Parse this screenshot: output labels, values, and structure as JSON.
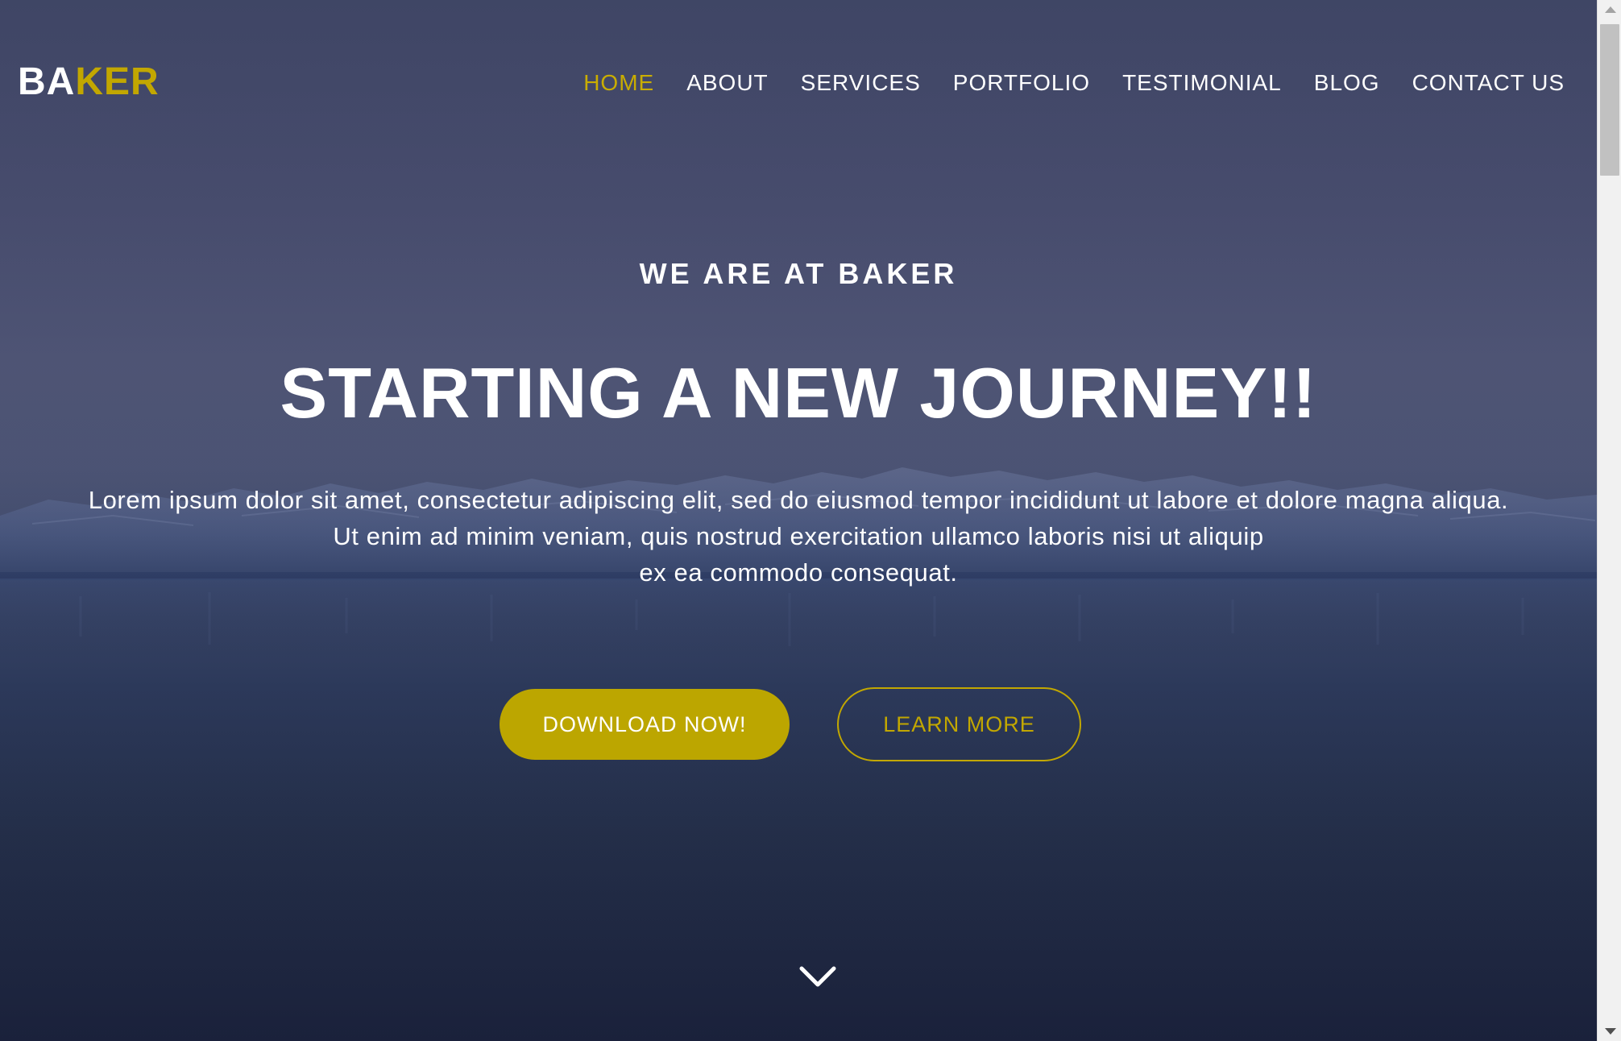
{
  "brand": {
    "logo_part1": "BA",
    "logo_part2": "KER",
    "accent_color": "#c2a700"
  },
  "nav": {
    "items": [
      {
        "label": "HOME",
        "active": true
      },
      {
        "label": "ABOUT",
        "active": false
      },
      {
        "label": "SERVICES",
        "active": false
      },
      {
        "label": "PORTFOLIO",
        "active": false
      },
      {
        "label": "TESTIMONIAL",
        "active": false
      },
      {
        "label": "BLOG",
        "active": false
      },
      {
        "label": "CONTACT US",
        "active": false
      }
    ]
  },
  "hero": {
    "eyebrow": "WE ARE AT BAKER",
    "headline": "STARTING A NEW JOURNEY!!",
    "lead_lines": [
      "Lorem ipsum dolor sit amet, consectetur adipiscing elit, sed do eiusmod tempor incididunt ut labore et dolore magna aliqua.",
      "Ut enim ad minim veniam, quis nostrud exercitation ullamco laboris nisi ut aliquip",
      "ex ea commodo consequat."
    ],
    "primary_button": "DOWNLOAD NOW!",
    "secondary_button": "LEARN MORE",
    "scroll_icon": "chevron-down-icon"
  },
  "colors": {
    "accent": "#c2a700",
    "button_fill": "#bca600",
    "text": "#ffffff"
  }
}
